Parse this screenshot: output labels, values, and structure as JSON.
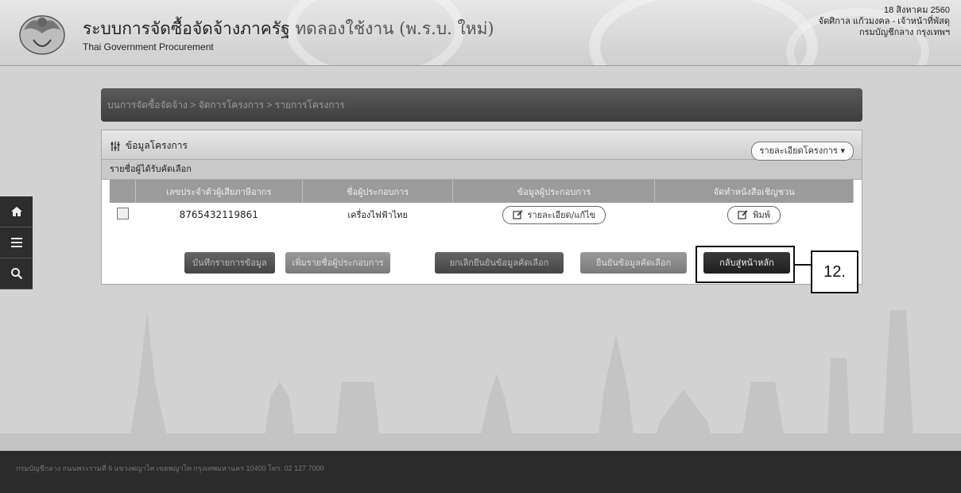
{
  "header": {
    "title": "ระบบการจัดซื้อจัดจ้างภาครัฐ",
    "title_suffix": "ทดลองใช้งาน (พ.ร.บ. ใหม่)",
    "subtitle": "Thai Government Procurement",
    "user": {
      "date": "18 สิงหาคม 2560",
      "name_role": "จัดศิกาล แก้วมงคล - เจ้าหน้าที่พัสดุ",
      "department": "กรมบัญชีกลาง กรุงเทพฯ"
    }
  },
  "sidebar": {
    "icons": [
      "home-icon",
      "menu-icon",
      "search-icon"
    ]
  },
  "breadcrumb": "บนการจัดซื้อจัดจ้าง > จัดการโครงการ > รายการโครงการ",
  "panel": {
    "title": "ข้อมูลโครงการ",
    "dropdown_label": "รายละเอียดโครงการ",
    "section_label": "รายชื่อผู้ได้รับคัดเลือก",
    "table": {
      "columns": [
        "เลขประจำตัวผู้เสียภาษีอากร",
        "ชื่อผู้ประกอบการ",
        "ข้อมูลผู้ประกอบการ",
        "จัดทำหนังสือเชิญชวน"
      ],
      "rows": [
        {
          "tax_id": "8765432119861",
          "vendor": "เครื่องไฟฟ้าไทย",
          "info_button": "รายละเอียด/แก้ไข",
          "print_button": "พิมพ์"
        }
      ]
    },
    "actions": [
      "บันทึกรายการข้อมูล",
      "เพิ่มรายชื่อผู้ประกอบการ",
      "ยกเลิกยืนยันข้อมูลคัดเลือก",
      "ยืนยันข้อมูลคัดเลือก",
      "กลับสู่หน้าหลัก"
    ]
  },
  "annotation": {
    "label": "12."
  },
  "footer": {
    "text": "กรมบัญชีกลาง ถนนพระรามที่ 6 แขวงพญาไท เขตพญาไท กรุงเทพมหานคร 10400 โทร. 02 127 7000"
  }
}
